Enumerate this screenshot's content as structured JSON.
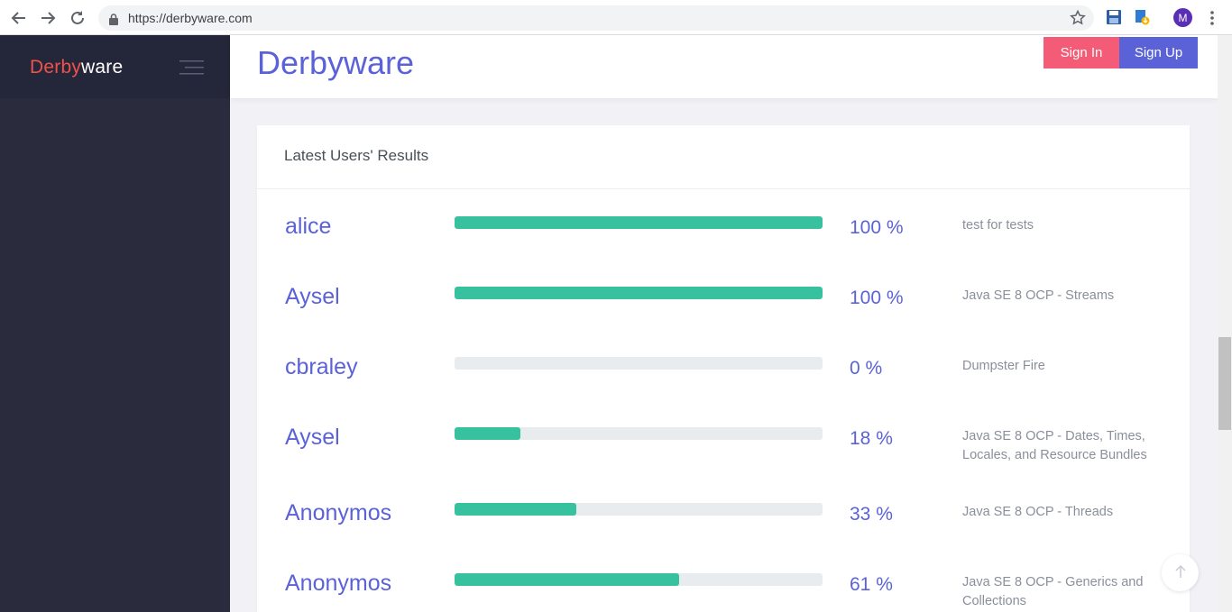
{
  "browser": {
    "url": "https://derbyware.com",
    "profile_initial": "M"
  },
  "sidebar": {
    "logo_part1": "Derby",
    "logo_part2": "ware"
  },
  "header": {
    "title": "Derbyware",
    "signin_label": "Sign In",
    "signup_label": "Sign Up"
  },
  "card": {
    "title": "Latest Users' Results",
    "rows": [
      {
        "user": "alice",
        "percent_label": "100 %",
        "percent": 100,
        "test": "test for tests"
      },
      {
        "user": "Aysel",
        "percent_label": "100 %",
        "percent": 100,
        "test": "Java SE 8 OCP - Streams"
      },
      {
        "user": "cbraley",
        "percent_label": "0 %",
        "percent": 0,
        "test": "Dumpster Fire"
      },
      {
        "user": "Aysel",
        "percent_label": "18 %",
        "percent": 18,
        "test": "Java SE 8 OCP - Dates, Times, Locales, and Resource Bundles"
      },
      {
        "user": "Anonymos",
        "percent_label": "33 %",
        "percent": 33,
        "test": "Java SE 8 OCP - Threads"
      },
      {
        "user": "Anonymos",
        "percent_label": "61 %",
        "percent": 61,
        "test": "Java SE 8 OCP - Generics and Collections"
      }
    ]
  },
  "colors": {
    "brand": "#5b62d8",
    "signin": "#f45b76",
    "progress": "#38c19f",
    "sidebar": "#2a2c3d",
    "logo_accent": "#f0524a"
  },
  "icons": {
    "back": "back-arrow-icon",
    "forward": "forward-arrow-icon",
    "reload": "reload-icon",
    "lock": "lock-icon",
    "bookmark": "star-icon",
    "save_extension": "floppy-disk-icon",
    "extension": "extension-icon",
    "menu": "kebab-menu-icon",
    "sidebar_toggle": "hamburger-icon",
    "scroll_top": "arrow-up-icon"
  }
}
